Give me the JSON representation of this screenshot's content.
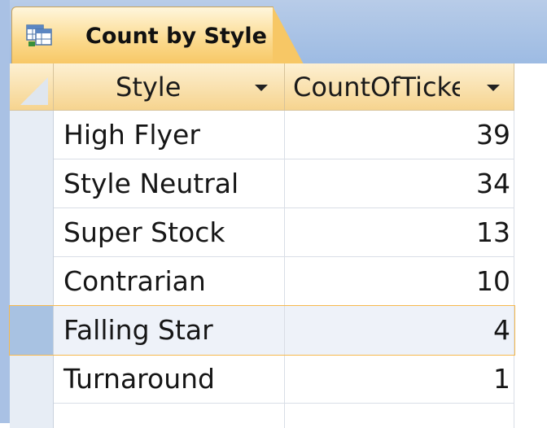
{
  "tab": {
    "label": "Count by Style",
    "icon": "query-datasheet-icon"
  },
  "columns": [
    {
      "label": "Style"
    },
    {
      "label": "CountOfTicker"
    }
  ],
  "rows": [
    {
      "style": "High Flyer",
      "count": "39"
    },
    {
      "style": "Style Neutral",
      "count": "34"
    },
    {
      "style": "Super Stock",
      "count": "13"
    },
    {
      "style": "Contrarian",
      "count": "10"
    },
    {
      "style": "Falling Star",
      "count": "4"
    },
    {
      "style": "Turnaround",
      "count": "1"
    }
  ],
  "selected_row": 4,
  "colors": {
    "tab_background": "#f7c765",
    "header_background": "#f6d48f",
    "selection_border": "#f6b94e",
    "tabstrip_background": "#9dbbe3"
  }
}
